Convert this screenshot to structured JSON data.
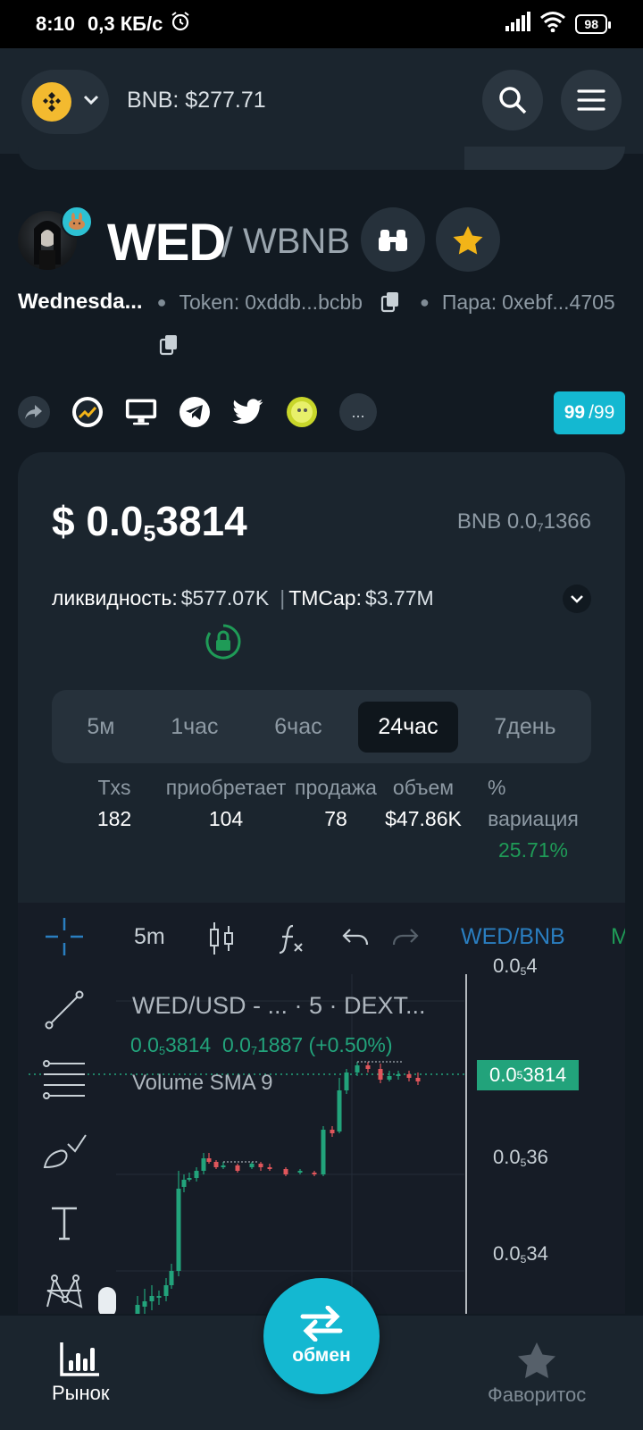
{
  "status_bar": {
    "time": "8:10",
    "speed": "0,3 КБ/с",
    "battery": "98"
  },
  "header": {
    "chain_price": "BNB: $277.71"
  },
  "token": {
    "symbol": "WED",
    "slash": "/",
    "quote": "WBNB",
    "name": "Wednesda...",
    "token_label": "Token:",
    "token_addr": "0xddb...bcbb",
    "pair_label": "Пара:",
    "pair_addr": "0xebf...4705"
  },
  "social": {
    "more": "...",
    "score": "99",
    "score_max": "/99"
  },
  "price_card": {
    "usd_prefix": "$ 0.0",
    "usd_sub": "5",
    "usd_rest": "3814",
    "bnb_prefix": "BNB 0.0",
    "bnb_sub": "7",
    "bnb_rest": "1366",
    "liquidity_label": "ликвидность:",
    "liquidity_value": "$577.07K",
    "mcap_label": "TMCap:",
    "mcap_value": "$3.77M"
  },
  "timeframes": [
    "5м",
    "1час",
    "6час",
    "24час",
    "7день"
  ],
  "active_timeframe": "24час",
  "stats": {
    "txs_label": "Txs",
    "txs": "182",
    "buys_label": "приобретает",
    "buys": "104",
    "sells_label": "продажа",
    "sells": "78",
    "volume_label": "объем",
    "volume": "$47.86K",
    "var_label": "%",
    "var_label2": "вариация",
    "var_value": "25.71%"
  },
  "chart": {
    "interval": "5m",
    "pair": "WED/BNB",
    "more": "M",
    "legend_title": "WED/USD - ... · 5 · DEXT...",
    "legend_value_1_prefix": "0.0",
    "legend_value_1_sub": "5",
    "legend_value_1_rest": "3814",
    "legend_value_2_prefix": "0.0",
    "legend_value_2_sub": "7",
    "legend_value_2_rest": "1887 (+0.50%)",
    "volume_label": "Volume SMA 9",
    "axis": [
      {
        "prefix": "0.0",
        "sub": "5",
        "rest": "4"
      },
      {
        "prefix": "0.0",
        "sub": "5",
        "rest": "36"
      },
      {
        "prefix": "0.0",
        "sub": "5",
        "rest": "34"
      }
    ],
    "current_tag": {
      "prefix": "0.0",
      "sub": "5",
      "rest": "3814"
    },
    "up_color": "#22a37b",
    "down_color": "#e0565b"
  },
  "bottom_nav": {
    "market": "Рынок",
    "swap": "обмен",
    "favorites": "Фаворитос"
  },
  "colors": {
    "accent": "#14b8d1",
    "positive": "#1f9b57",
    "background": "#121a22"
  }
}
